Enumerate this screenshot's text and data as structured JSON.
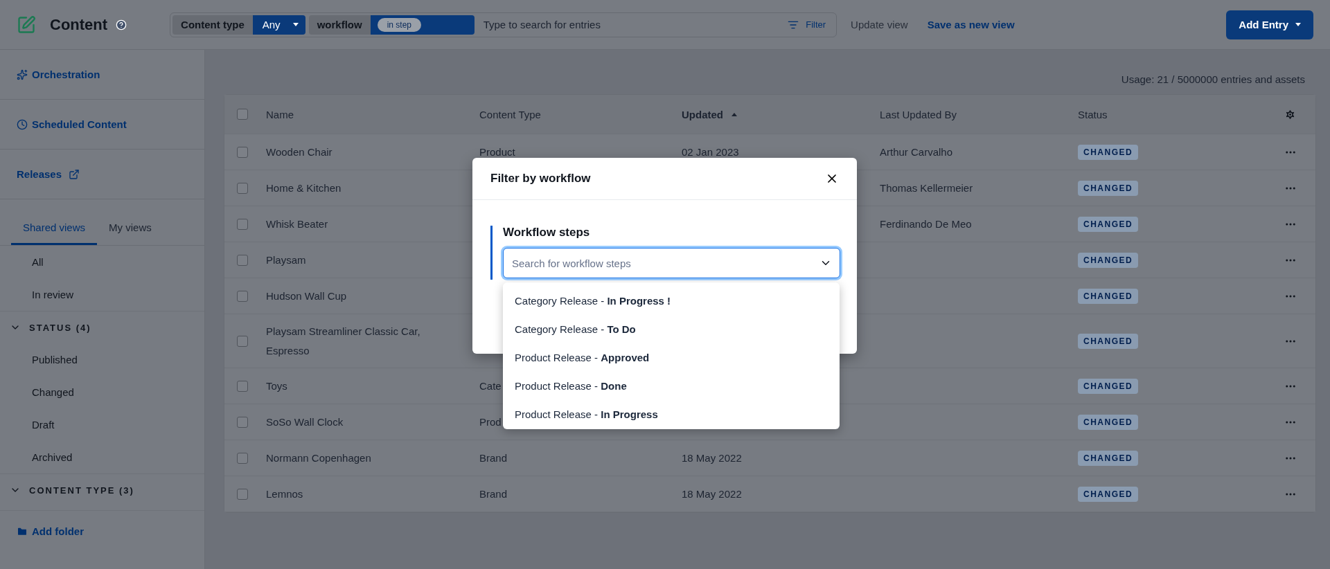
{
  "header": {
    "title": "Content",
    "content_type_label": "Content type",
    "content_type_value": "Any",
    "workflow_label": "workflow",
    "workflow_chip": "in step",
    "search_placeholder": "Type to search for entries",
    "filter": "Filter",
    "update_view": "Update view",
    "save_view": "Save as new view",
    "add_entry": "Add Entry"
  },
  "sidebar": {
    "links": [
      {
        "kind": "orchestration",
        "label": "Orchestration"
      },
      {
        "kind": "scheduled",
        "label": "Scheduled Content"
      },
      {
        "kind": "external",
        "label": "Releases"
      }
    ],
    "tabs": [
      {
        "label": "Shared views",
        "selected": true
      },
      {
        "label": "My views",
        "selected": false
      }
    ],
    "views": [
      "All",
      "In review"
    ],
    "folders": [
      {
        "label": "STATUS (4)",
        "expanded": true,
        "children": [
          "Published",
          "Changed",
          "Draft",
          "Archived"
        ]
      },
      {
        "label": "CONTENT TYPE (3)",
        "expanded": true
      }
    ],
    "add_folder": "Add folder"
  },
  "usage": "Usage: 21 / 5000000 entries and assets",
  "table": {
    "all_checked": false,
    "columns": [
      {
        "label": "Name",
        "sorted": false
      },
      {
        "label": "Content Type",
        "sorted": false
      },
      {
        "label": "Updated",
        "sorted": true
      },
      {
        "label": "Last Updated By",
        "sorted": false
      },
      {
        "label": "Status",
        "sorted": false
      }
    ],
    "rows": [
      {
        "checked": false,
        "name": "Wooden Chair",
        "content_type": "Product",
        "updated": "02 Jan 2023",
        "by": "Arthur Carvalho",
        "status": "CHANGED"
      },
      {
        "checked": false,
        "name": "Home & Kitchen",
        "by": "Thomas Kellermeier",
        "status": "CHANGED"
      },
      {
        "checked": false,
        "name": "Whisk Beater",
        "by": "Ferdinando De Meo",
        "status": "CHANGED"
      },
      {
        "checked": false,
        "name": "Playsam",
        "status": "CHANGED"
      },
      {
        "checked": false,
        "name": "Hudson Wall Cup",
        "status": "CHANGED"
      },
      {
        "checked": false,
        "name": "Playsam Streamliner Classic Car, Espresso",
        "status": "CHANGED"
      },
      {
        "checked": false,
        "name": "Toys",
        "content_type": "Cate",
        "status": "CHANGED"
      },
      {
        "checked": false,
        "name": "SoSo Wall Clock",
        "content_type": "Prod",
        "status": "CHANGED"
      },
      {
        "checked": false,
        "name": "Normann Copenhagen",
        "content_type": "Brand",
        "updated": "18 May 2022",
        "status": "CHANGED"
      },
      {
        "checked": false,
        "name": "Lemnos",
        "content_type": "Brand",
        "updated": "18 May 2022",
        "status": "CHANGED"
      }
    ]
  },
  "modal": {
    "title": "Filter by workflow",
    "field_label": "Workflow steps",
    "placeholder": "Search for workflow steps",
    "options": [
      "Category Release - **In Progress !**",
      "Category Release - **To Do**",
      "Product Release - **Approved**",
      "Product Release - **Done**",
      "Product Release - **In Progress**"
    ]
  }
}
